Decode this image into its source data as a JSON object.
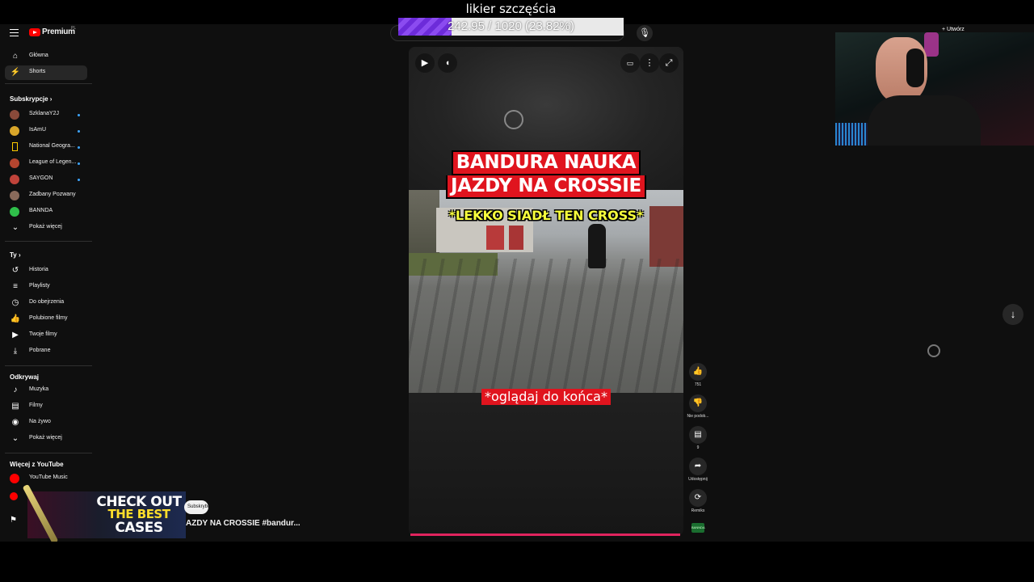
{
  "overlay": {
    "goal_title": "likier szczęścia",
    "goal_text": "242.95 / 1020 (23.82%)",
    "goal_fraction": 0.2382
  },
  "header": {
    "logo_text": "Premium",
    "logo_sup": "PL",
    "create_label": "+ Utwórz"
  },
  "sidebar": {
    "main": [
      {
        "label": "Główna",
        "icon": "home-icon",
        "glyph": "⌂"
      },
      {
        "label": "Shorts",
        "icon": "shorts-icon",
        "glyph": "⚡"
      }
    ],
    "subs_title": "Subskrypcje  ›",
    "subs": [
      {
        "label": "SzklanaY2J",
        "color": "#8a4a3a",
        "dot": true
      },
      {
        "label": "IsAmU",
        "color": "#d9a62a",
        "dot": true
      },
      {
        "label": "National Geogra...",
        "color": "",
        "dot": true
      },
      {
        "label": "League of Legen...",
        "color": "#b5452f",
        "dot": true
      },
      {
        "label": "SAYGON",
        "color": "#c0433a",
        "dot": true
      },
      {
        "label": "Zadbany Pozwany",
        "color": "#8a6a5a",
        "dot": false
      },
      {
        "label": "BANNDA",
        "color": "#2fbf4a",
        "dot": false
      }
    ],
    "subs_more": "Pokaż więcej",
    "you_title": "Ty  ›",
    "you": [
      {
        "label": "Historia",
        "icon": "history-icon",
        "glyph": "↺"
      },
      {
        "label": "Playlisty",
        "icon": "playlists-icon",
        "glyph": "≡"
      },
      {
        "label": "Do obejrzenia",
        "icon": "watch-later-icon",
        "glyph": "◷"
      },
      {
        "label": "Polubione filmy",
        "icon": "liked-icon",
        "glyph": "👍"
      },
      {
        "label": "Twoje filmy",
        "icon": "your-videos-icon",
        "glyph": "▶"
      },
      {
        "label": "Pobrane",
        "icon": "downloads-icon",
        "glyph": "⤓"
      }
    ],
    "explore_title": "Odkrywaj",
    "explore": [
      {
        "label": "Muzyka",
        "icon": "music-icon",
        "glyph": "♪"
      },
      {
        "label": "Filmy",
        "icon": "movies-icon",
        "glyph": "▤"
      },
      {
        "label": "Na żywo",
        "icon": "live-icon",
        "glyph": "◉"
      },
      {
        "label": "Pokaż więcej",
        "icon": "chevron-down-icon",
        "glyph": "⌄"
      }
    ],
    "more_title": "Więcej z YouTube",
    "more": [
      {
        "label": "YouTube Music",
        "color": "#f00"
      }
    ]
  },
  "video": {
    "caption_line1": "BANDURA NAUKA",
    "caption_line2": "JAZDY NA CROSSIE",
    "caption_yellow": "*LEKKO SIADŁ TEN CROSS*",
    "caption_bottom": "*oglądaj do końca*"
  },
  "actions": {
    "like_count": "751",
    "dislike_label": "Nie podob...",
    "comments_count": "9",
    "share_label": "Udostępnij",
    "remix_label": "Remiks",
    "sound_label": "BANNDA"
  },
  "promo": {
    "line1": "CHECK OUT",
    "line2": "THE BEST",
    "line3": "CASES"
  },
  "bottom": {
    "subscribe_label": "Subskrybuj",
    "video_title": "AZDY NA CROSSIE #bandur..."
  }
}
